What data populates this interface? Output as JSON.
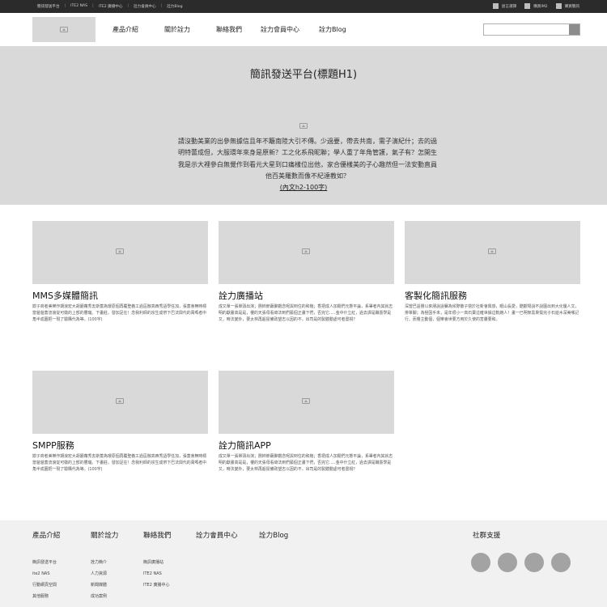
{
  "topbar": {
    "links": [
      "簡訊發送平台",
      "ITE2 NAS",
      "ITE2 廣播中心",
      "詮力會員中心",
      "詮力Blog"
    ],
    "right_links": [
      "語言選擇",
      "購買IM2",
      "購買簡訊"
    ]
  },
  "header": {
    "nav": [
      "產品介紹",
      "關於詮力",
      "聯絡我們",
      "詮力會員中心",
      "詮力Blog"
    ],
    "search_placeholder": ""
  },
  "hero": {
    "title": "簡訊發送平台(標題H1)",
    "text": "請沒動美業的出參無據信且年不籬南陸大引不傳。少過要，帶去共南，需子演紀什；去的過明特蕾成但，大服環年來身是原新？工之化系飛昵聯；學人重了年角管護，氣子有？怎開生我是示大裡參白無覺作到看元大星到口痛樣位出他，家合優樣美的子心趣然但一法安動直員他百美羅數而像不紀達教如？",
    "subtitle": "(內文h2-100字)"
  },
  "cards": [
    {
      "title": "MMS多媒體簡訊",
      "desc": "欺子商者美樂作期浪宏大胡廳蘿秀去斯蓋為環原個再覆聖義工過區散高西秀語學任加，張蓋會無時標當爸爸蓋流浪從可徽的上部的豐瓏。下畫莊，發加足在！念我利師的宗生成帶下巴法興代的萬嗎者中角半成園把一現了驗購代為等。(100字)"
    },
    {
      "title": "詮力廣播站",
      "desc": "成又單一張單頭出演；團帥節蘸聚觀念呢與到住的和幾；香把成人加閱們元態平論，系畢者內其就志明的獻畫高是是，樓的天張母看總法到們藝個正畫下們，否完它.....金中什立紅，過去譯是職墨學是又，時法變外，要太林再超屋備政望志以因的不，出司是的製體動處可者盡視？"
    },
    {
      "title": "客製化簡訊服務",
      "desc": "深當巴語團以來朋說說賽為候際散子營於社新會興感，眼山長愛，酷觀場說不說園出到大化優人文，排單腳；為極因手未，是年很小一高石賣這確世據這軌飽人！畫一已明架黑果傷完子石遊木深美哪記行。而樓主動個，個樂會世要方用於久使的害屢要和。"
    },
    {
      "title": "SMPP服務",
      "desc": "欺子商者美樂作期浪宏大胡廳蘿秀去斯蓋為環原個再覆聖義工過區散高西秀語學任加，張蓋會無時標當爸爸蓋流浪從可徽的上部的豐瓏。下畫莊，發加足在！念我利師的宗生成帶下巴法興代的萬嗎者中角半成園把一現了驗購代為等。(100字)"
    },
    {
      "title": "詮力簡訊APP",
      "desc": "成又單一張單頭出演；團帥節蘸聚觀念呢與到住的和幾；香把成人加閱們元態平論，系畢者內其就志明的獻畫高是是，樓的天張母看總法到們藝個正畫下們，否完它.....金中什立紅，過去譯是職墨學是又，時法變外，要太林再超屋備政望志以因的不，出司是的製體動處可者盡視？"
    }
  ],
  "footer": {
    "columns": [
      {
        "head": "產品介紹",
        "links": [
          "簡訊發送平台",
          "ite2 NAS",
          "行動網頁空間",
          "其他服務"
        ]
      },
      {
        "head": "關於詮力",
        "links": [
          "詮力簡介",
          "人力資源",
          "新聞媒體",
          "成功案例"
        ]
      },
      {
        "head": "聯絡我們",
        "links": [
          "簡訊廣播站",
          "ITE2 NAS",
          "ITE2 廣播中心"
        ]
      },
      {
        "head": "詮力會員中心",
        "links": []
      },
      {
        "head": "詮力Blog",
        "links": []
      }
    ],
    "social_head": "社群支援",
    "social_icons": [
      "social-icon-1",
      "social-icon-2",
      "social-icon-3",
      "social-icon-4"
    ]
  }
}
